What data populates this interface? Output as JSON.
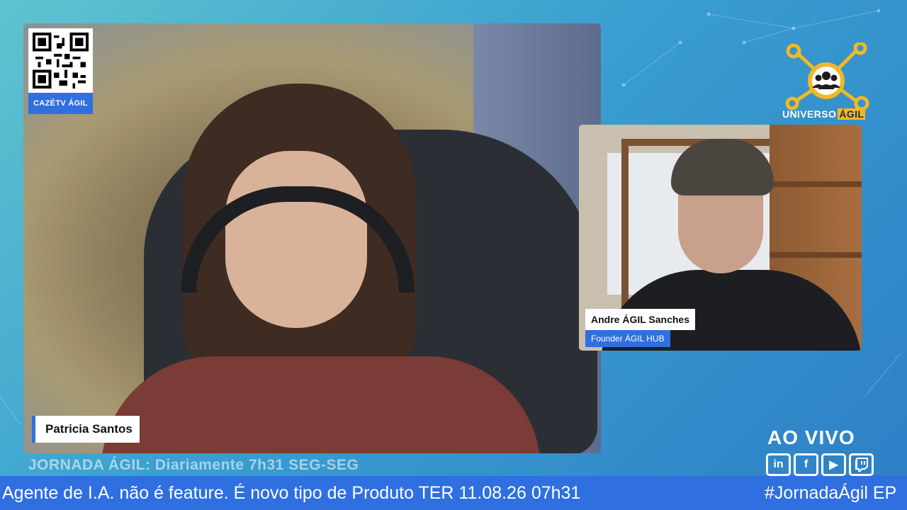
{
  "overlay": {
    "qr_label": "CAZÉTV ÁGIL",
    "main_speaker_name": "Patricia Santos",
    "guest_name": "Andre ÁGIL Sanches",
    "guest_role": "Founder ÁGIL HUB",
    "logo_text_main": "UNIVERSO",
    "logo_text_accent": "ÁGIL",
    "live_label": "AO VIVO",
    "show_subtitle": "JORNADA ÁGIL: Diariamente 7h31 SEG-SEG",
    "ticker_text": "Agente de I.A. não é feature. É novo tipo de Produto TER 11.08.26 07h31",
    "ticker_hashtag": "#JornadaÁgil EP"
  },
  "socials": [
    {
      "icon": "linkedin-icon",
      "label": "in"
    },
    {
      "icon": "facebook-icon",
      "label": "f"
    },
    {
      "icon": "youtube-icon",
      "label": "▶"
    },
    {
      "icon": "twitch-icon",
      "label": ""
    }
  ],
  "colors": {
    "accent_blue": "#2f6fe0",
    "logo_gold": "#f2b824"
  }
}
